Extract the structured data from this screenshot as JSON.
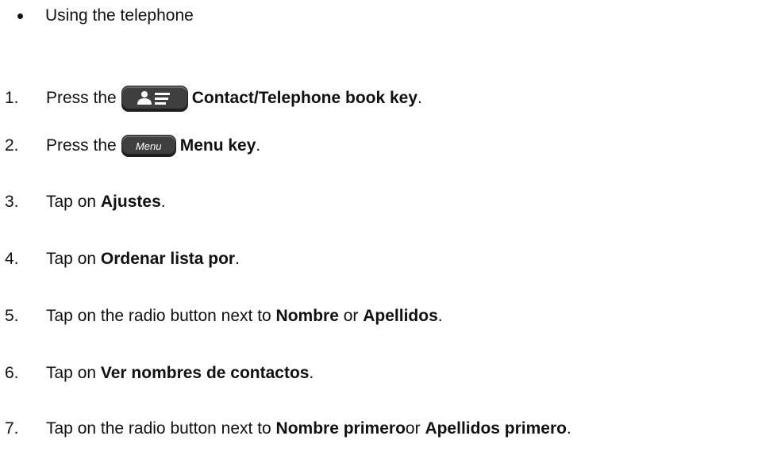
{
  "intro_bullet": "Using the telephone",
  "steps": [
    {
      "num": "1.",
      "pre": "Press the",
      "bold": "Contact/Telephone book key",
      "post": "."
    },
    {
      "num": "2.",
      "pre": "Press the",
      "key_label": "Menu",
      "bold": "Menu key",
      "post": "."
    },
    {
      "num": "3.",
      "pre": "Tap on ",
      "bold": "Ajustes",
      "post": "."
    },
    {
      "num": "4.",
      "pre": "Tap on ",
      "bold": "Ordenar lista por",
      "post": "."
    },
    {
      "num": "5.",
      "pre": "Tap on the radio button next to ",
      "bold": "Nombre",
      "mid": " or ",
      "bold2": "Apellidos",
      "post": "."
    },
    {
      "num": "6.",
      "pre": "Tap on ",
      "bold": "Ver nombres de contactos",
      "post": "."
    },
    {
      "num": "7.",
      "pre": "Tap on the radio button next to ",
      "bold": "Nombre primero",
      "mid": "or ",
      "bold2": "Apellidos primero",
      "post": "."
    }
  ],
  "icons": {
    "contact_key": "contact-book-key-icon",
    "menu_key": "menu-key-icon"
  },
  "colors": {
    "text": "#111111",
    "key_body": "#3f3f3f"
  }
}
